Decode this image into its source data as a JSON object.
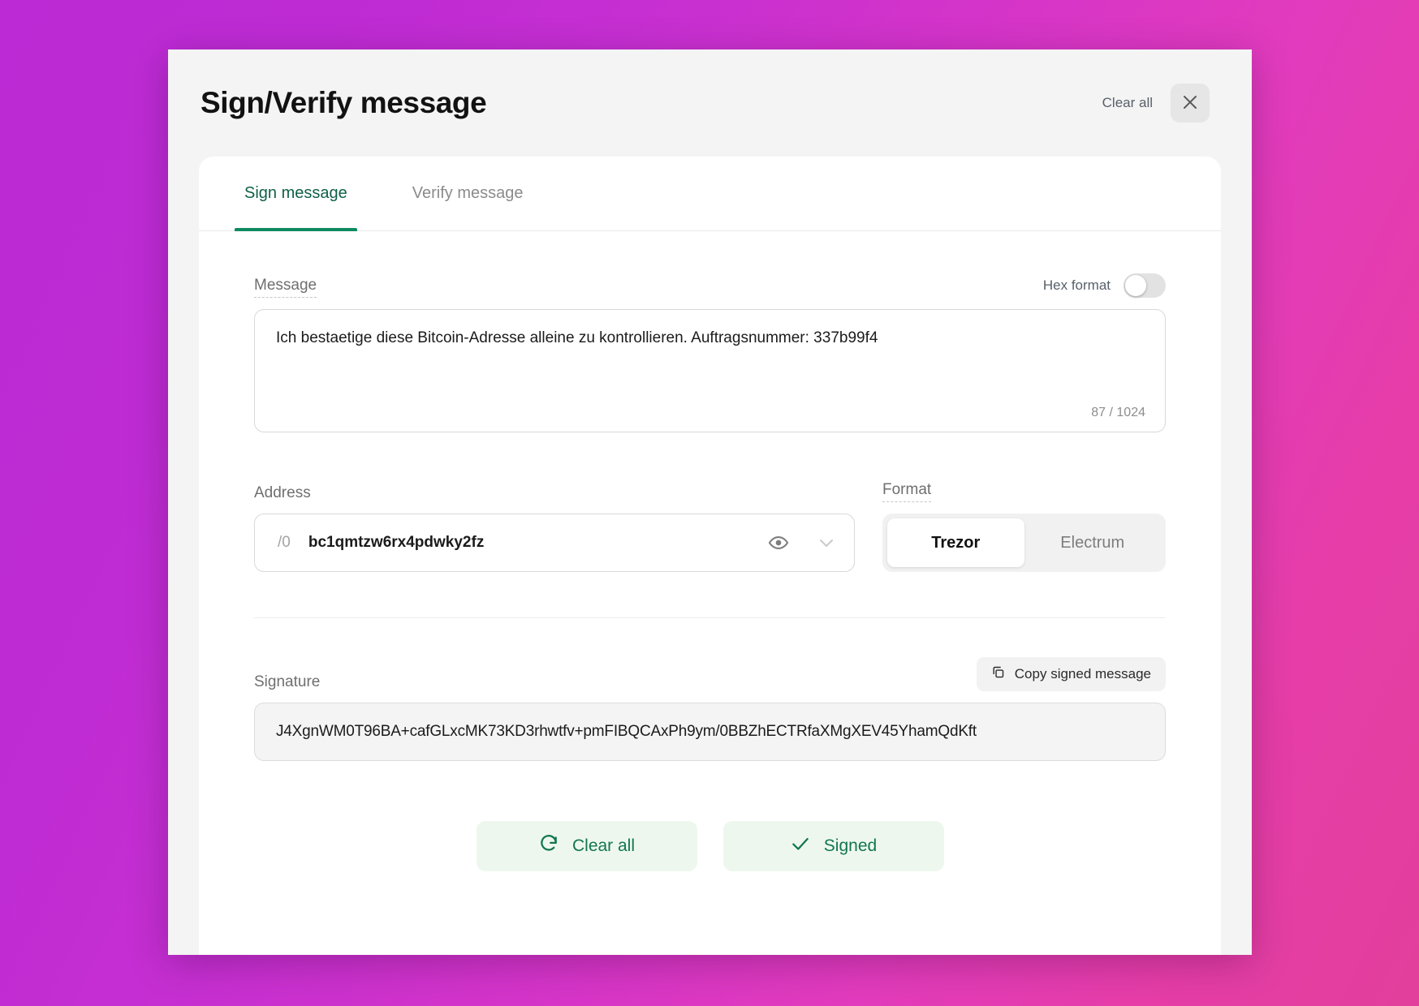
{
  "window": {
    "title": "Sign/Verify message",
    "clear_all_label": "Clear all",
    "close_icon": "close-icon"
  },
  "tabs": [
    {
      "label": "Sign message",
      "active": true
    },
    {
      "label": "Verify message",
      "active": false
    }
  ],
  "message": {
    "label": "Message",
    "hex_toggle_label": "Hex format",
    "hex_toggle_state": "off",
    "value": "Ich bestaetige diese Bitcoin-Adresse alleine zu kontrollieren. Auftragsnummer: 337b99f4",
    "char_count": "87 / 1024"
  },
  "address": {
    "label": "Address",
    "index": "/0",
    "value": "bc1qmtzw6rx4pdwky2fz",
    "eye_icon": "eye-icon",
    "chevron_icon": "chevron-down-icon"
  },
  "format": {
    "label": "Format",
    "options": [
      {
        "label": "Trezor",
        "active": true
      },
      {
        "label": "Electrum",
        "active": false
      }
    ]
  },
  "signature": {
    "label": "Signature",
    "copy_label": "Copy signed message",
    "copy_icon": "copy-icon",
    "value": "J4XgnWM0T96BA+cafGLxcMK73KD3rhwtfv+pmFIBQCAxPh9ym/0BBZhECTRfaXMgXEV45YhamQdKft"
  },
  "actions": [
    {
      "label": "Clear all",
      "icon": "refresh-icon"
    },
    {
      "label": "Signed",
      "icon": "check-icon"
    }
  ],
  "colors": {
    "accent_green": "#0f8a5f",
    "button_green_text": "#11774f",
    "button_green_bg": "#eef7ee",
    "gradient_start": "#bb2ad4",
    "gradient_end": "#e23f9c"
  }
}
